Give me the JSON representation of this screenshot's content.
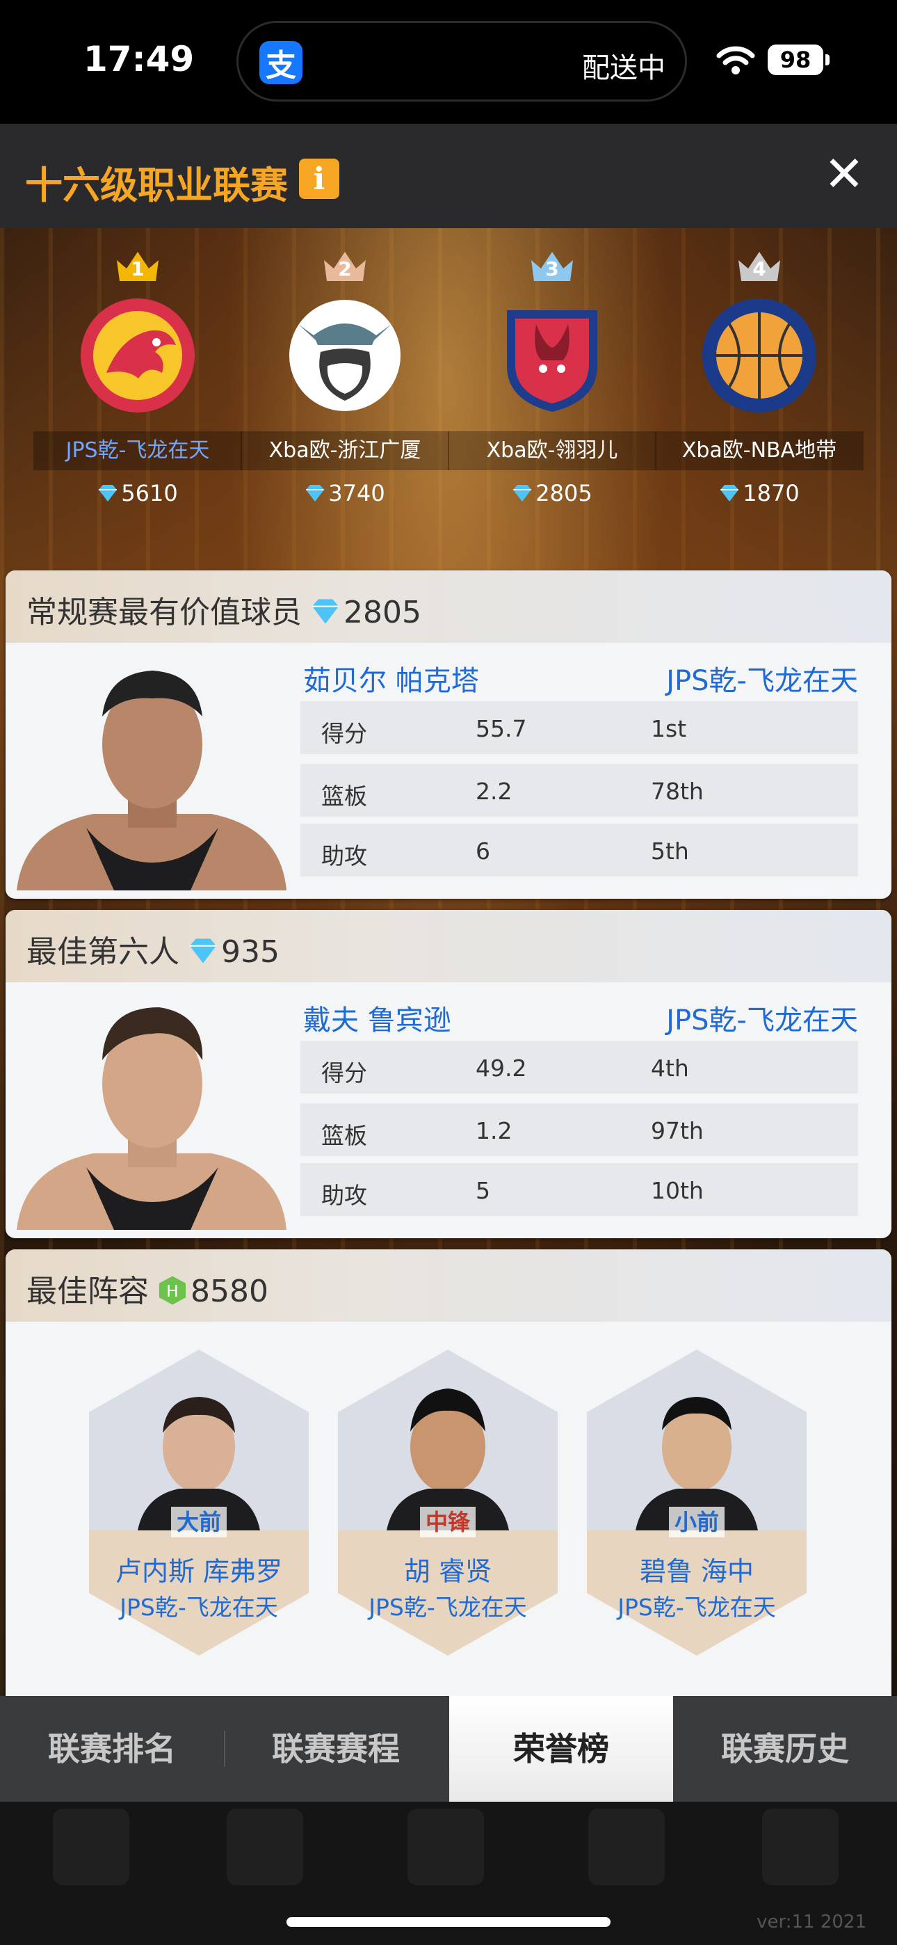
{
  "status_bar": {
    "time": "17:49",
    "island_label": "配送中",
    "alipay_glyph": "支",
    "battery": "98"
  },
  "header": {
    "title": "十六级职业联赛",
    "info_glyph": "i",
    "close_glyph": "✕"
  },
  "leaderboard": [
    {
      "rank": "1",
      "team": "JPS乾-飞龙在天",
      "score": "5610",
      "crown_color": "#f2b705"
    },
    {
      "rank": "2",
      "team": "Xba欧-浙江广厦",
      "score": "3740",
      "crown_color": "#e8b99a"
    },
    {
      "rank": "3",
      "team": "Xba欧-翎羽儿",
      "score": "2805",
      "crown_color": "#8cc8f0"
    },
    {
      "rank": "4",
      "team": "Xba欧-NBA地带",
      "score": "1870",
      "crown_color": "#c9c9c9"
    }
  ],
  "mvp": {
    "title": "常规赛最有价值球员",
    "value": "2805",
    "player": "茹贝尔 帕克塔",
    "team": "JPS乾-飞龙在天",
    "stats": [
      {
        "label": "得分",
        "value": "55.7",
        "rank": "1st"
      },
      {
        "label": "篮板",
        "value": "2.2",
        "rank": "78th"
      },
      {
        "label": "助攻",
        "value": "6",
        "rank": "5th"
      }
    ]
  },
  "sixth_man": {
    "title": "最佳第六人",
    "value": "935",
    "player": "戴夫 鲁宾逊",
    "team": "JPS乾-飞龙在天",
    "stats": [
      {
        "label": "得分",
        "value": "49.2",
        "rank": "4th"
      },
      {
        "label": "篮板",
        "value": "1.2",
        "rank": "97th"
      },
      {
        "label": "助攻",
        "value": "5",
        "rank": "10th"
      }
    ]
  },
  "best_lineup": {
    "title": "最佳阵容",
    "value": "8580",
    "players": [
      {
        "position": "大前",
        "name": "卢内斯 库弗罗",
        "team": "JPS乾-飞龙在天"
      },
      {
        "position": "中锋",
        "name": "胡 睿贤",
        "team": "JPS乾-飞龙在天"
      },
      {
        "position": "小前",
        "name": "碧鲁 海中",
        "team": "JPS乾-飞龙在天"
      }
    ]
  },
  "tabs": [
    {
      "label": "联赛排名"
    },
    {
      "label": "联赛赛程"
    },
    {
      "label": "荣誉榜"
    },
    {
      "label": "联赛历史"
    }
  ],
  "version": "ver:11  2021"
}
